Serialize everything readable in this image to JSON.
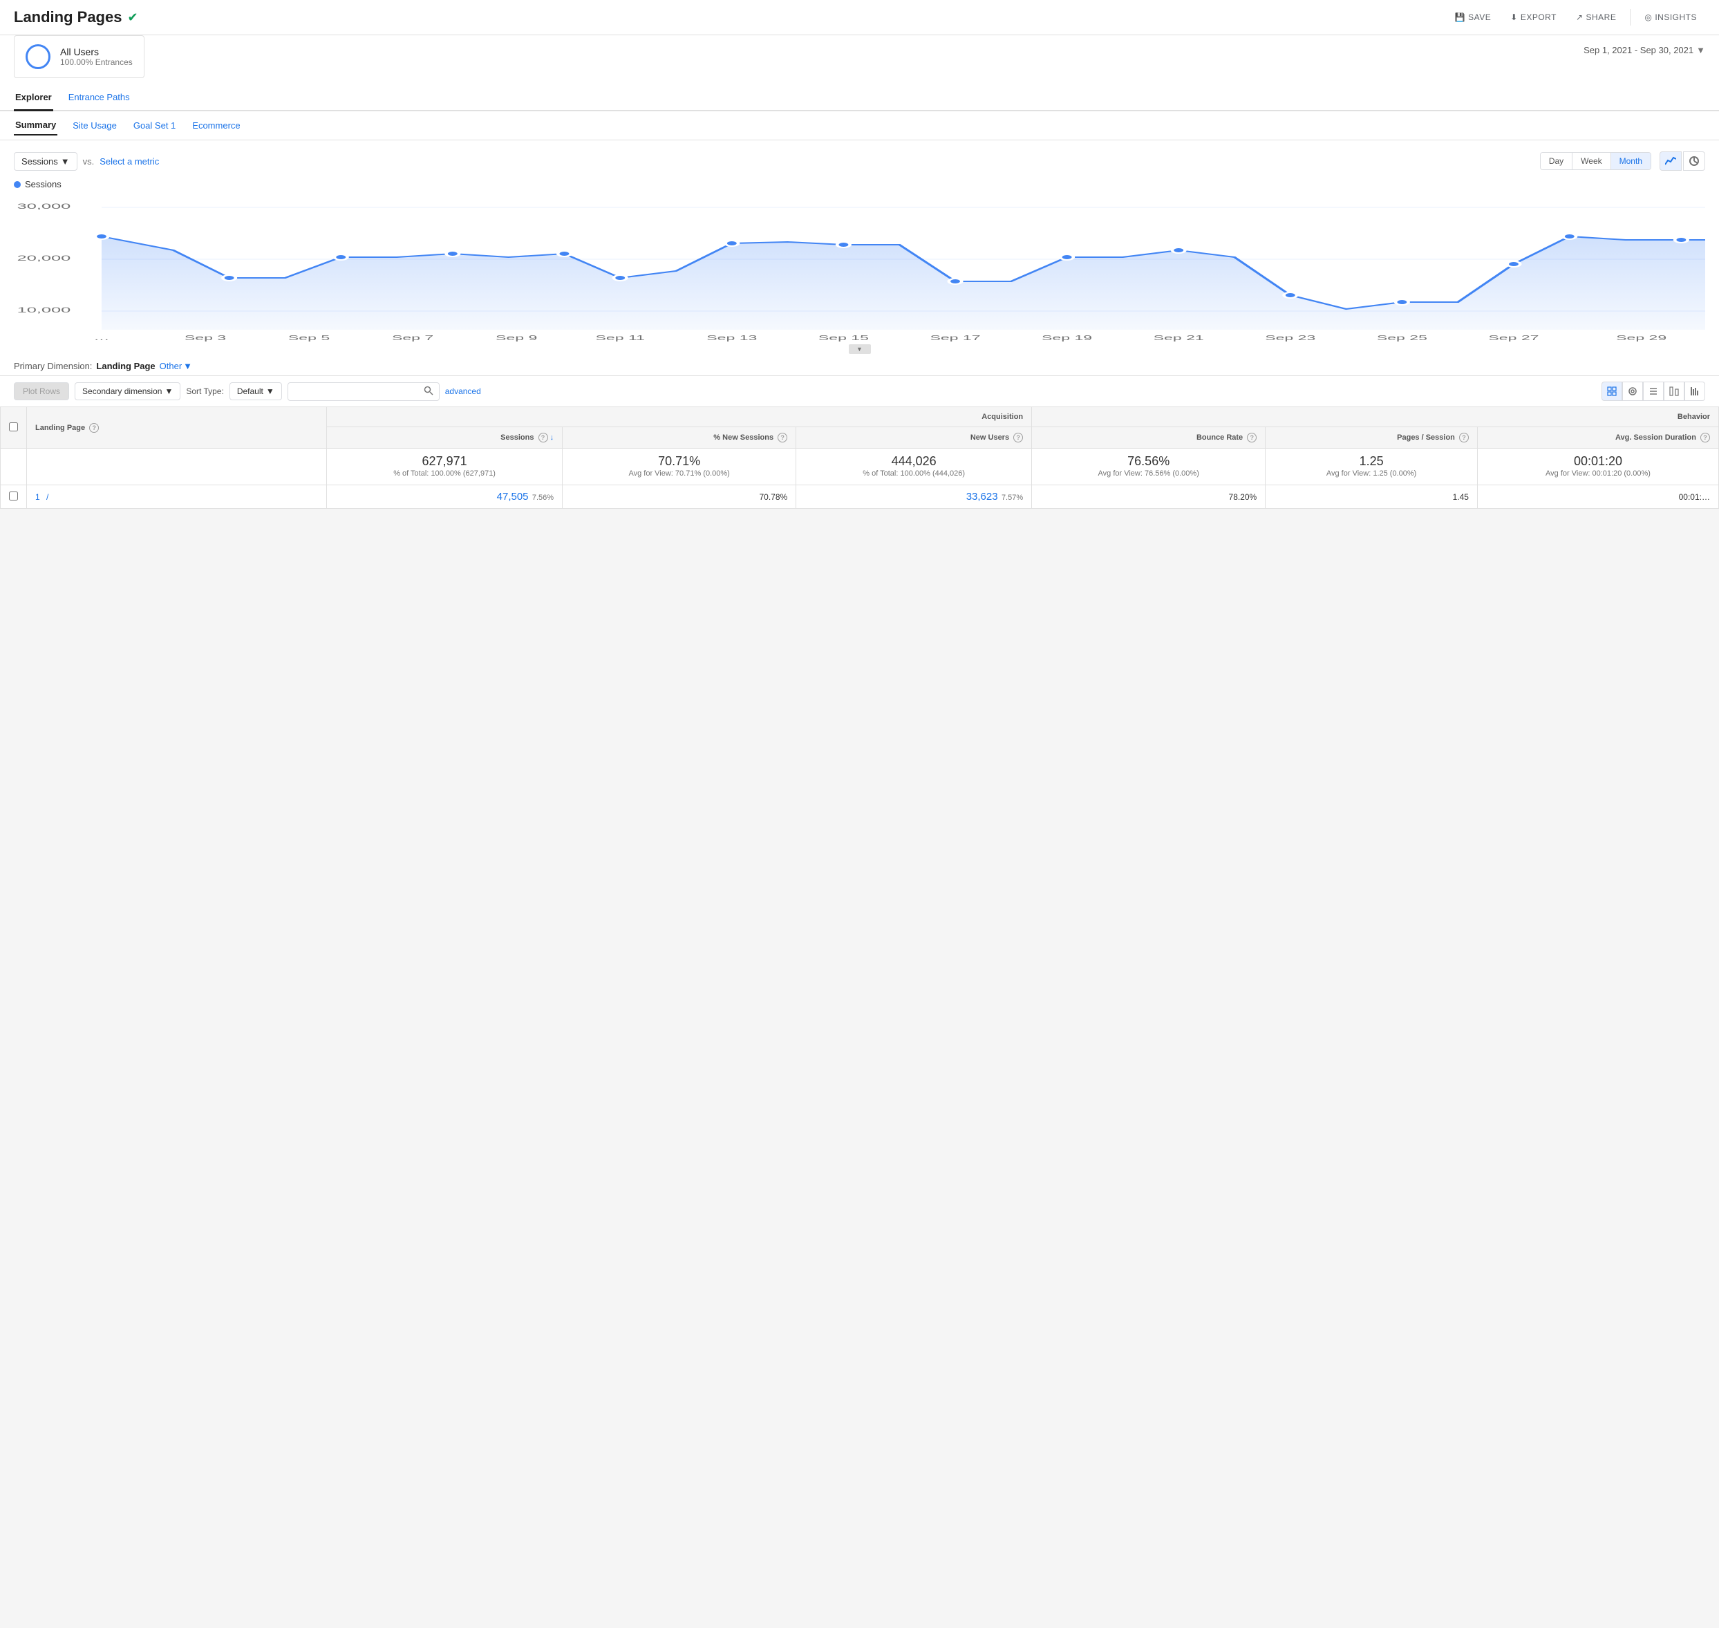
{
  "header": {
    "title": "Landing Pages",
    "actions": {
      "save": "SAVE",
      "export": "EXPORT",
      "share": "SHARE",
      "insights": "INSIGHTS"
    }
  },
  "segment": {
    "name": "All Users",
    "subtitle": "100.00% Entrances"
  },
  "dateRange": {
    "label": "Sep 1, 2021 - Sep 30, 2021"
  },
  "tabs": {
    "main": [
      "Explorer",
      "Entrance Paths"
    ],
    "activeMain": 0,
    "sub": [
      "Summary",
      "Site Usage",
      "Goal Set 1",
      "Ecommerce"
    ],
    "activeSub": 0
  },
  "chart": {
    "metricLabel": "Sessions",
    "vsLabel": "vs.",
    "selectMetric": "Select a metric",
    "timeButtons": [
      "Day",
      "Week",
      "Month"
    ],
    "activeTime": 2,
    "yLabels": [
      "30,000",
      "20,000",
      "10,000"
    ],
    "xLabels": [
      "…",
      "Sep 3",
      "Sep 5",
      "Sep 7",
      "Sep 9",
      "Sep 11",
      "Sep 13",
      "Sep 15",
      "Sep 17",
      "Sep 19",
      "Sep 21",
      "Sep 23",
      "Sep 25",
      "Sep 27",
      "Sep 29"
    ],
    "legend": "Sessions"
  },
  "primaryDimension": {
    "label": "Primary Dimension:",
    "value": "Landing Page",
    "otherLabel": "Other"
  },
  "tableControls": {
    "plotRows": "Plot Rows",
    "secDim": "Secondary dimension",
    "sortLabel": "Sort Type:",
    "sortValue": "Default",
    "searchPlaceholder": "",
    "advanced": "advanced"
  },
  "tableHeaders": {
    "dimCol": "Landing Page",
    "acquisitionGroup": "Acquisition",
    "behaviorGroup": "Behavior",
    "cols": [
      "Sessions",
      "% New Sessions",
      "New Users",
      "Bounce Rate",
      "Pages / Session",
      "Avg. Session Duration"
    ]
  },
  "totals": {
    "sessions": "627,971",
    "sessionsTotal": "% of Total: 100.00% (627,971)",
    "pctNewSessions": "70.71%",
    "pctNewSessionsAvg": "Avg for View: 70.71% (0.00%)",
    "newUsers": "444,026",
    "newUsersTotal": "% of Total: 100.00% (444,026)",
    "bounceRate": "76.56%",
    "bounceRateAvg": "Avg for View: 76.56% (0.00%)",
    "pagesPerSession": "1.25",
    "pagesAvg": "Avg for View: 1.25 (0.00%)",
    "avgSessionDur": "00:01:20",
    "avgSessionDurAvg": "Avg for View: 00:01:20 (0.00%)"
  },
  "row1": {
    "num": "1",
    "url": "/",
    "sessions": "47,505",
    "sessionsPct": "7.56%",
    "pctNew": "70.78%",
    "newUsers": "33,623",
    "newUsersPct": "7.57%",
    "bounceRate": "78.20%",
    "pagesPerSession": "1.45",
    "avgDur": "00:01:…"
  }
}
